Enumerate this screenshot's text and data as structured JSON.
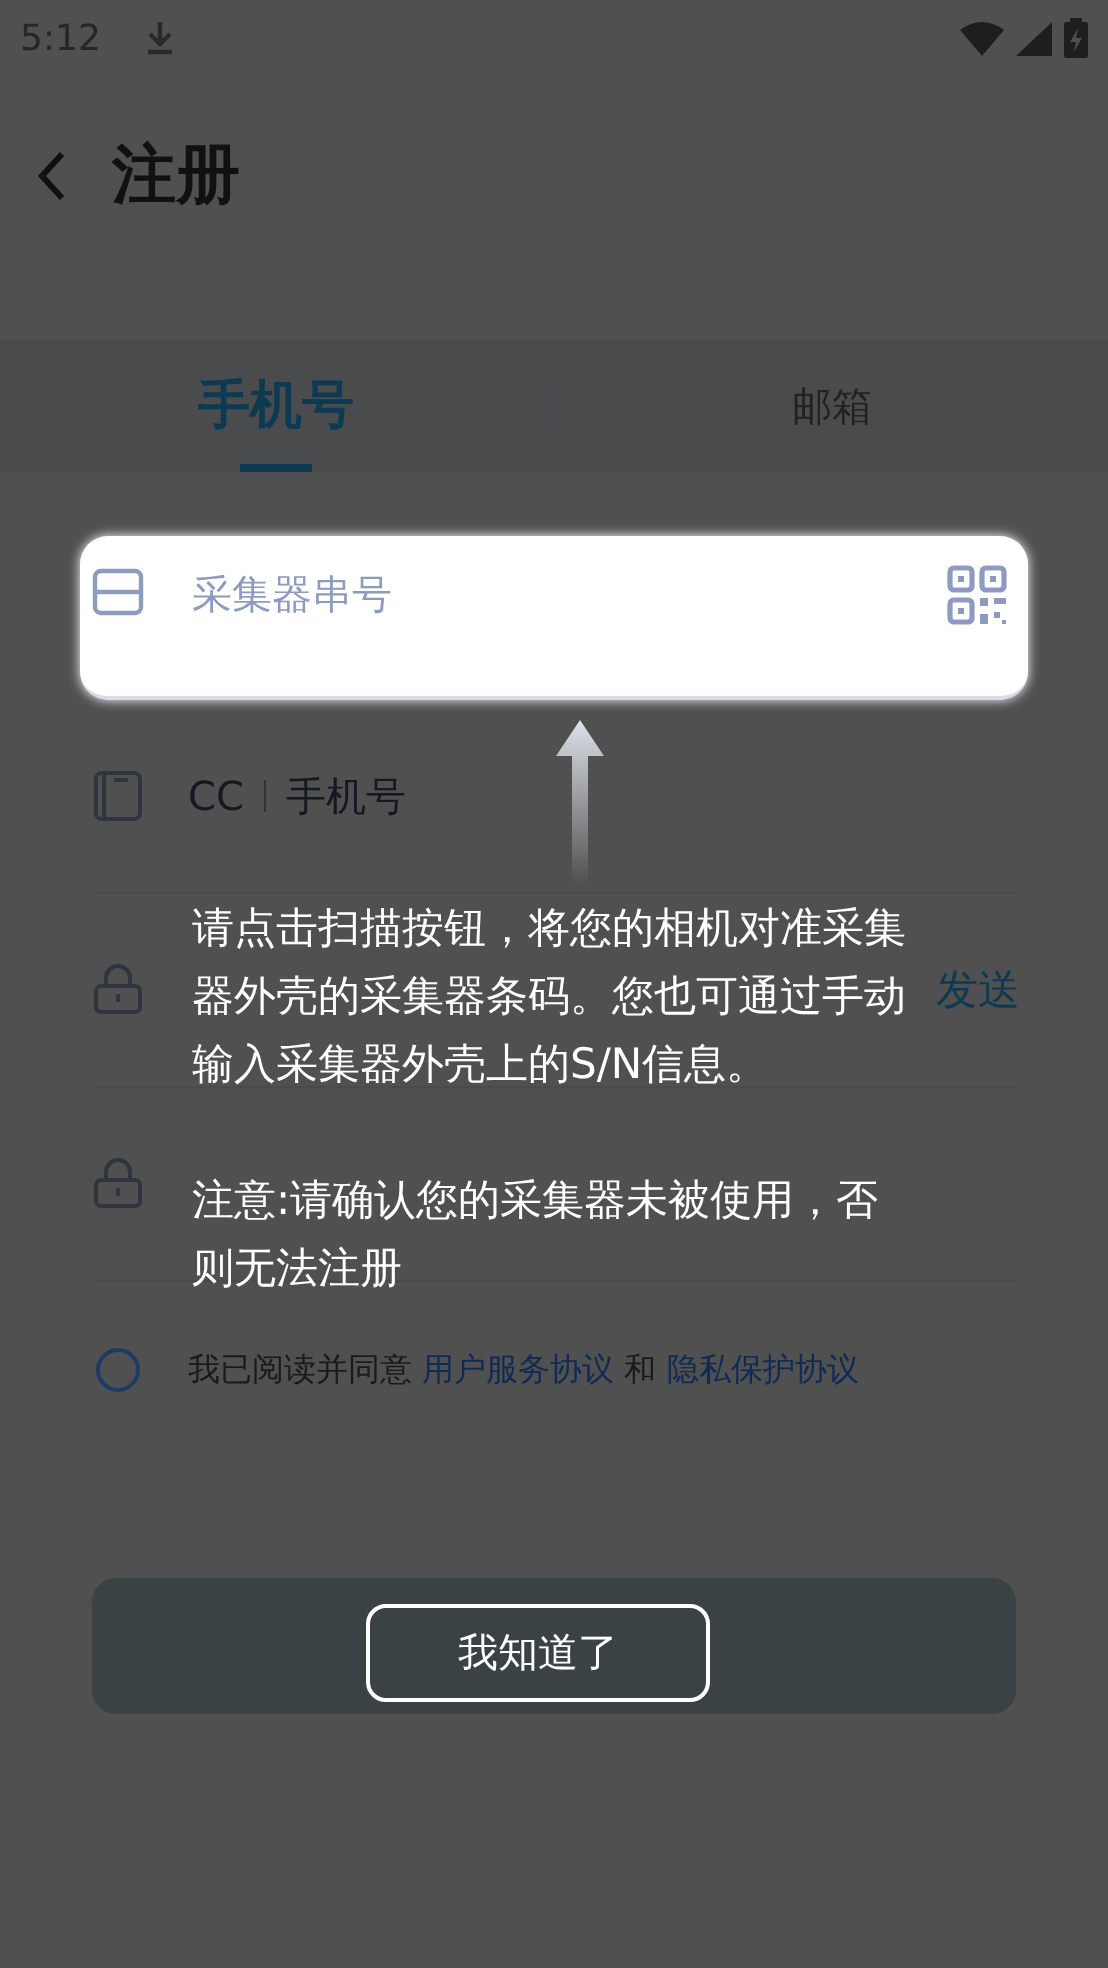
{
  "status_bar": {
    "time": "5:12"
  },
  "header": {
    "title": "注册"
  },
  "tabs": [
    {
      "label": "手机号",
      "selected": true
    },
    {
      "label": "邮箱",
      "selected": false
    }
  ],
  "form": {
    "serial_field": {
      "placeholder": "采集器串号"
    },
    "phone_field": {
      "country_code": "CC",
      "placeholder": "手机号"
    },
    "code_field": {
      "send_label": "发送"
    },
    "agreement": {
      "checked": false,
      "text": "我已阅读并同意",
      "link_1": "用户服务协议",
      "joiner": "和",
      "link_2": "隐私保护协议"
    }
  },
  "guide": {
    "hint": "请点击扫描按钮，将您的相机对准采集器外壳的采集器条码。您也可通过手动输入采集器外壳上的S/N信息。",
    "note": "注意:请确认您的采集器未被使用，否则无法注册",
    "button": "我知道了"
  }
}
